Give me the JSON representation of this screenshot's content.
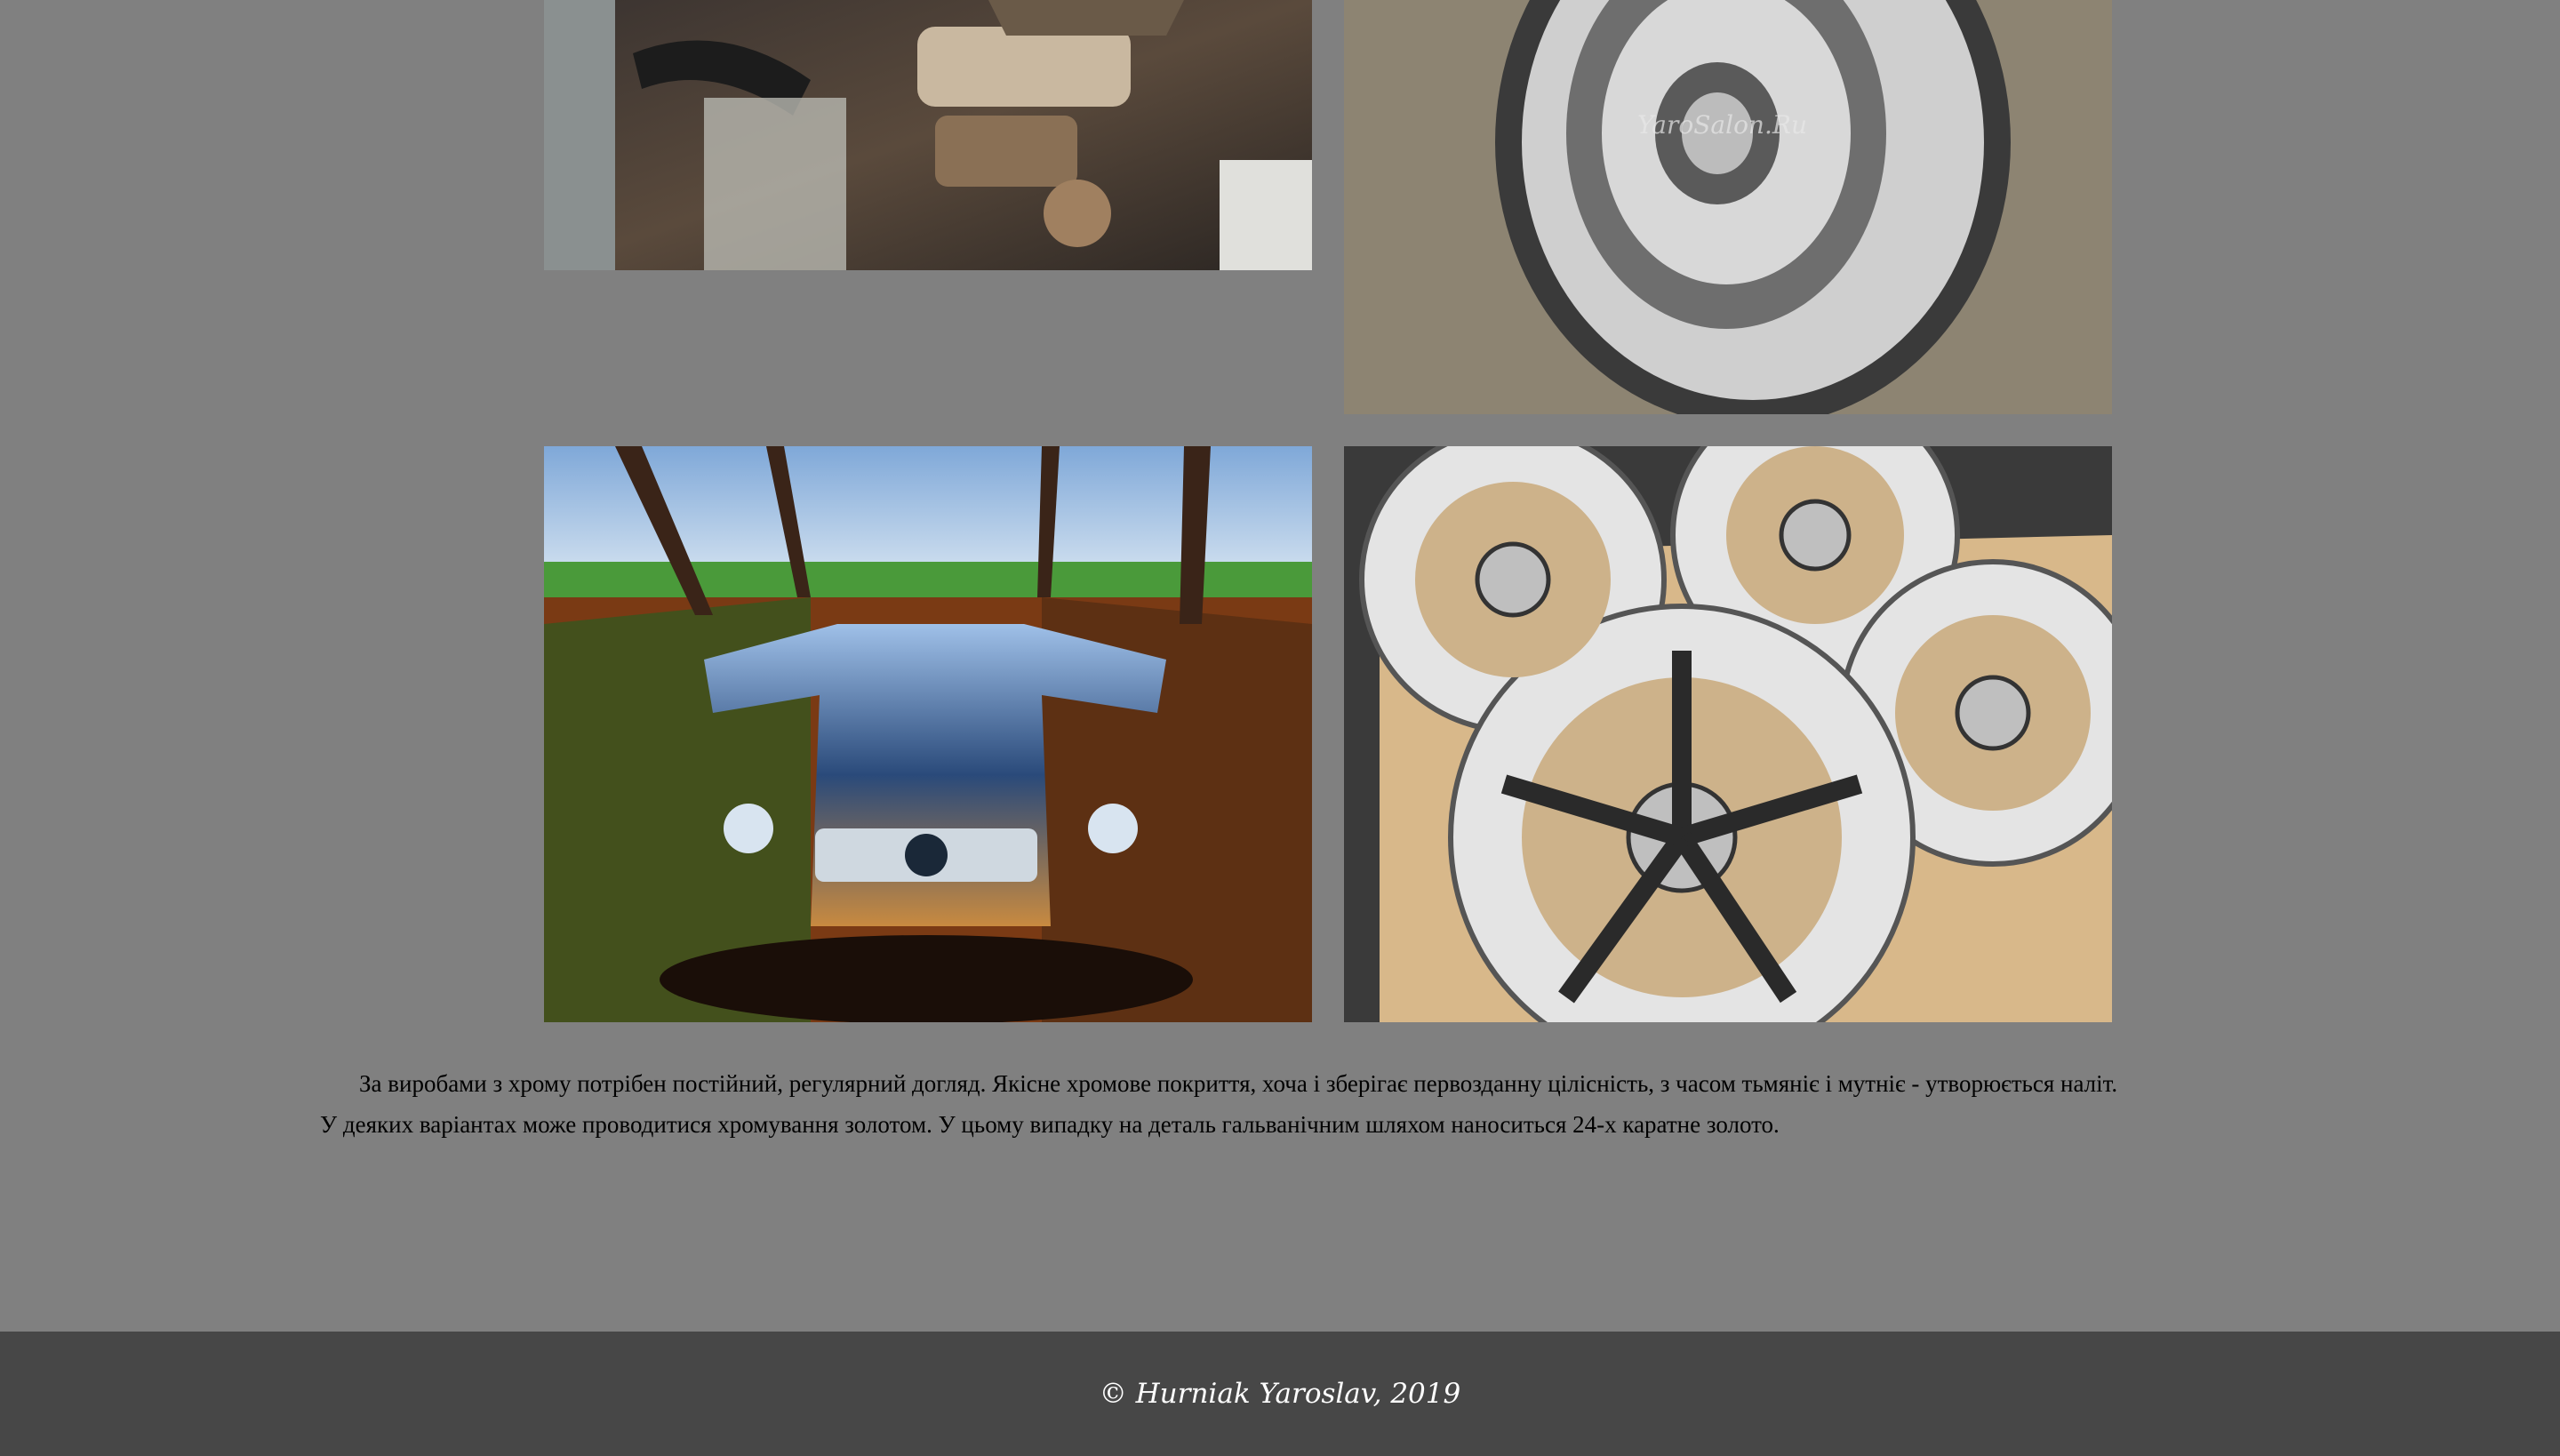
{
  "gallery": {
    "images": [
      {
        "alt": "chrome-engine-photo"
      },
      {
        "alt": "chrome-wheel-photo",
        "watermark": "YaroSalon.Ru"
      },
      {
        "alt": "chrome-car-photo"
      },
      {
        "alt": "chrome-rims-photo"
      }
    ]
  },
  "article": {
    "paragraph_1": "За виробами з хрому потрібен постійний, регулярний догляд. Якісне хромове покриття, хоча і зберігає первозданну цілісність, з часом тьмяніє і мутніє - утворюється наліт.",
    "paragraph_2": "У деяких варіантах може проводитися хромування золотом. У цьому випадку на деталь гальванічним шляхом наноситься 24-х каратне золото."
  },
  "footer": {
    "copyright": "© Hurniak Yaroslav, 2019"
  },
  "colors": {
    "page_background": "#808080",
    "footer_background": "#474747",
    "footer_text": "#ffffff"
  }
}
